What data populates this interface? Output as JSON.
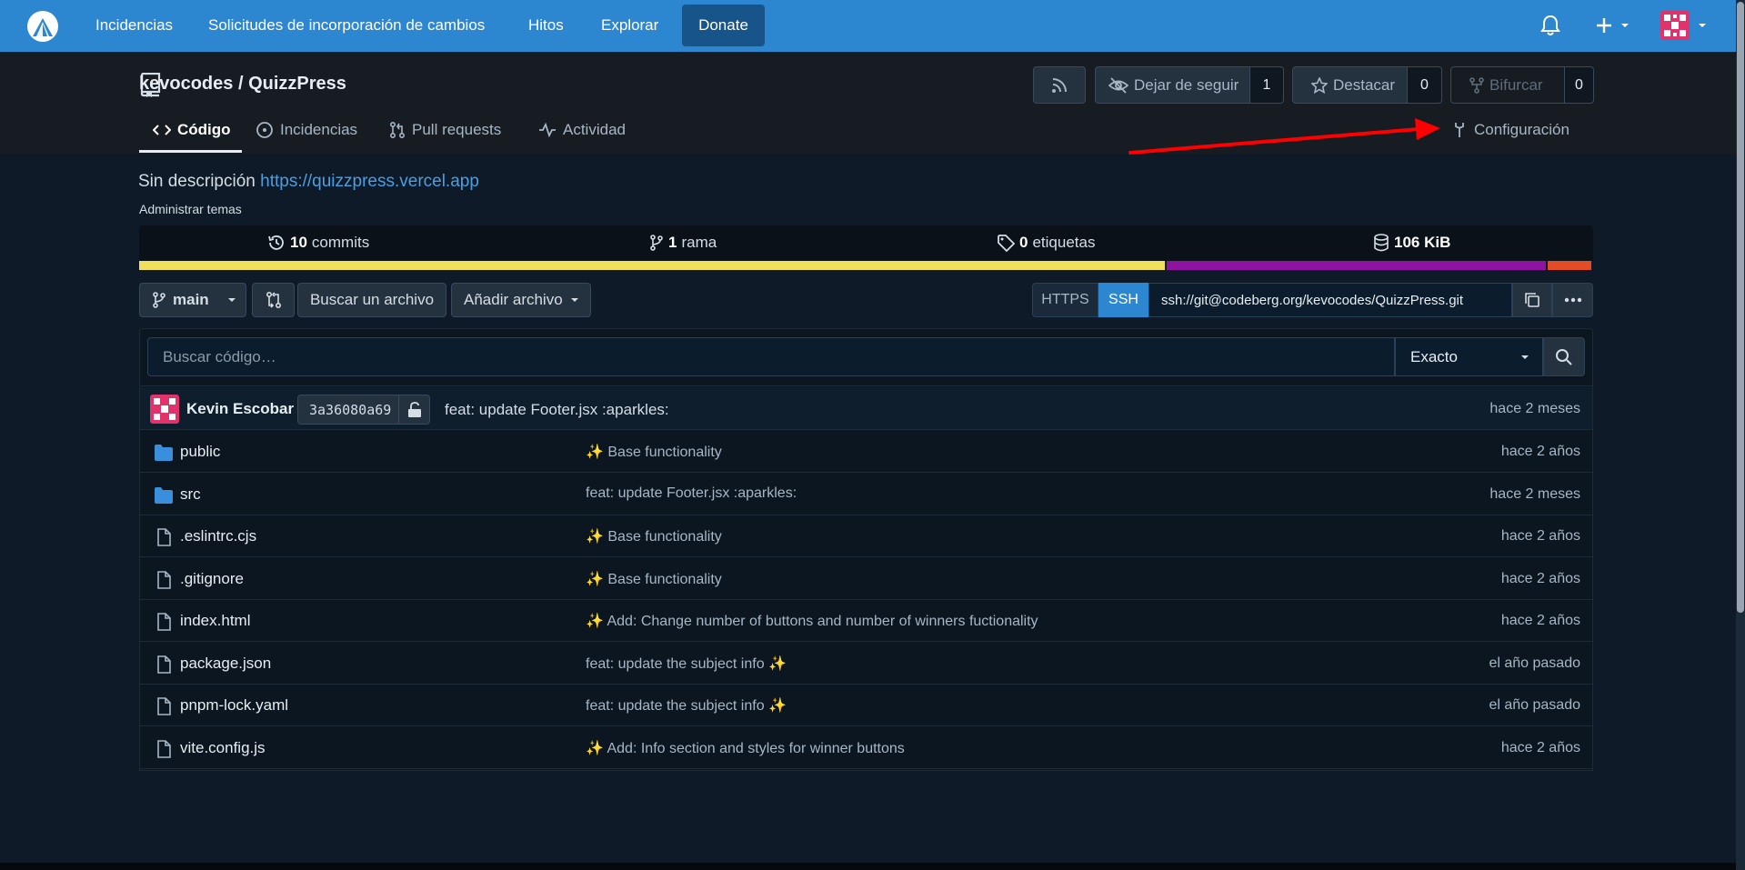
{
  "topnav": {
    "items": [
      "Incidencias",
      "Solicitudes de incorporación de cambios",
      "Hitos",
      "Explorar"
    ],
    "donate": "Donate"
  },
  "repo": {
    "owner": "kevocodes",
    "separator": " / ",
    "name": "QuizzPress",
    "unwatch_label": "Dejar de seguir",
    "watch_count": "1",
    "star_label": "Destacar",
    "star_count": "0",
    "fork_label": "Bifurcar",
    "fork_count": "0"
  },
  "tabs": {
    "code": "Código",
    "issues": "Incidencias",
    "pulls": "Pull requests",
    "activity": "Actividad",
    "settings": "Configuración"
  },
  "about": {
    "description": "Sin descripción",
    "website": "https://quizzpress.vercel.app",
    "manage_topics": "Administrar temas"
  },
  "stats": {
    "commits_count": "10",
    "commits_label": "commits",
    "branches_count": "1",
    "branches_label": "rama",
    "tags_count": "0",
    "tags_label": "etiquetas",
    "size": "106 KiB"
  },
  "languages": [
    {
      "color": "#f1e05a",
      "fraction": 0.707
    },
    {
      "color": "#8e13a0",
      "fraction": 0.262
    },
    {
      "color": "#e34c26",
      "fraction": 0.031
    }
  ],
  "actions": {
    "branch": "main",
    "find_file": "Buscar un archivo",
    "add_file": "Añadir archivo",
    "https": "HTTPS",
    "ssh": "SSH",
    "clone_url": "ssh://git@codeberg.org/kevocodes/QuizzPress.git"
  },
  "search": {
    "placeholder": "Buscar código…",
    "mode": "Exacto"
  },
  "latest_commit": {
    "author": "Kevin Escobar",
    "sha": "3a36080a69",
    "message": "feat: update Footer.jsx :aparkles:",
    "time": "hace 2 meses"
  },
  "files": [
    {
      "name": "public",
      "type": "folder",
      "message": "✨ Base functionality",
      "time": "hace 2 años"
    },
    {
      "name": "src",
      "type": "folder",
      "message": "feat: update Footer.jsx :aparkles:",
      "time": "hace 2 meses"
    },
    {
      "name": ".eslintrc.cjs",
      "type": "file",
      "message": "✨ Base functionality",
      "time": "hace 2 años"
    },
    {
      "name": ".gitignore",
      "type": "file",
      "message": "✨ Base functionality",
      "time": "hace 2 años"
    },
    {
      "name": "index.html",
      "type": "file",
      "message": "✨ Add: Change number of buttons and number of winners fuctionality",
      "time": "hace 2 años"
    },
    {
      "name": "package.json",
      "type": "file",
      "message": "feat: update the subject info ✨",
      "time": "el año pasado"
    },
    {
      "name": "pnpm-lock.yaml",
      "type": "file",
      "message": "feat: update the subject info ✨",
      "time": "el año pasado"
    },
    {
      "name": "vite.config.js",
      "type": "file",
      "message": "✨ Add: Info section and styles for winner buttons",
      "time": "hace 2 años"
    }
  ],
  "colors": {
    "topbar": "#2c86d0",
    "link": "#4a9fe3",
    "annotation_arrow": "#ff0000"
  }
}
